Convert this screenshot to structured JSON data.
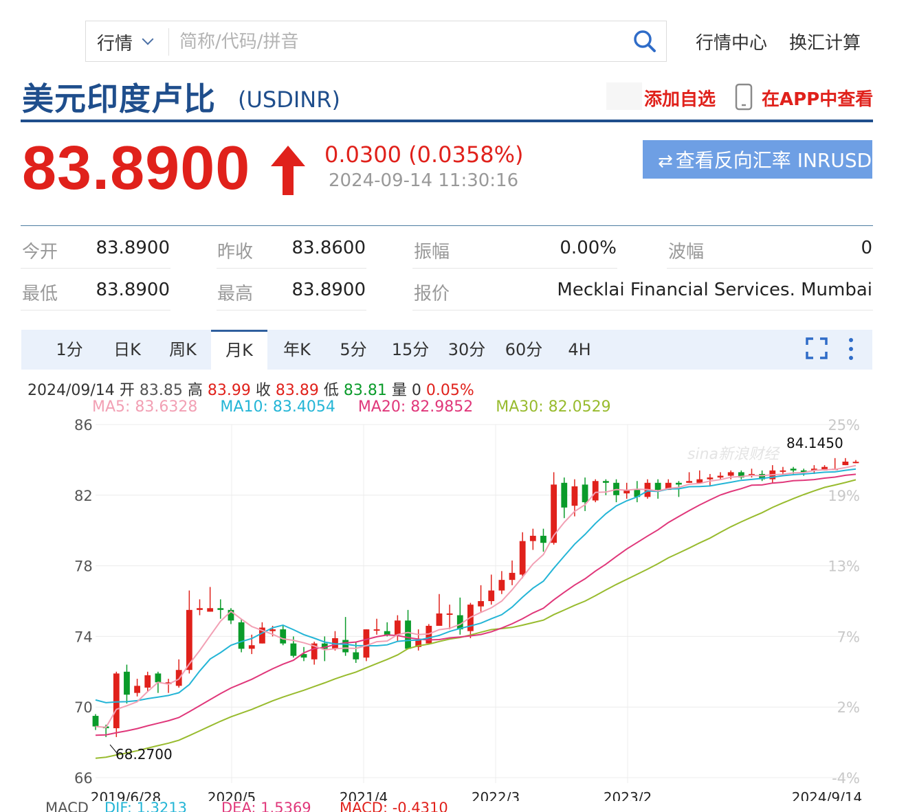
{
  "search": {
    "market_label": "行情",
    "placeholder": "简称/代码/拼音"
  },
  "nav": {
    "market_center": "行情中心",
    "fx_calc": "换汇计算"
  },
  "header": {
    "title": "美元印度卢比",
    "symbol": "(USDINR)",
    "add_favorite": "添加自选",
    "view_in_app": "在APP中查看"
  },
  "quote": {
    "price": "83.8900",
    "change": "0.0300 (0.0358%)",
    "timestamp": "2024-09-14 11:30:16",
    "reverse_button": "查看反向汇率 INRUSD",
    "up_color": "#e0211b"
  },
  "stats": {
    "open_label": "今开",
    "open_value": "83.8900",
    "prev_close_label": "昨收",
    "prev_close_value": "83.8600",
    "amplitude_label": "振幅",
    "amplitude_value": "0.00%",
    "wave_label": "波幅",
    "wave_value": "0",
    "low_label": "最低",
    "low_value": "83.8900",
    "high_label": "最高",
    "high_value": "83.8900",
    "quote_label": "报价",
    "quote_value": "Mecklai Financial Services. Mumbai"
  },
  "tabs": [
    "1分",
    "日K",
    "周K",
    "月K",
    "年K",
    "5分",
    "15分",
    "30分",
    "60分",
    "4H"
  ],
  "active_tab": "月K",
  "ohlc_bar": {
    "date": "2024/09/14",
    "open_label": "开",
    "open": "83.85",
    "high_label": "高",
    "high": "83.99",
    "close_label": "收",
    "close": "83.89",
    "low_label": "低",
    "low": "83.81",
    "volume_label": "量",
    "volume": "0",
    "pct": "0.05%"
  },
  "ma_legend": {
    "ma5": "MA5: 83.6328",
    "ma10": "MA10: 83.4054",
    "ma20": "MA20: 82.9852",
    "ma30": "MA30: 82.0529"
  },
  "macd_legend": {
    "title": "MACD",
    "dif": "DIF: 1.3213",
    "dea": "DEA: 1.5369",
    "macd": "MACD: -0.4310"
  },
  "chart_data": {
    "type": "candlestick",
    "title": "",
    "y_ticks": [
      86,
      82,
      78,
      74,
      70,
      66
    ],
    "right_ticks": [
      "25%",
      "19%",
      "13%",
      "7%",
      "2%",
      "-4%"
    ],
    "ylim": [
      66,
      86
    ],
    "x_ticks": [
      "2019/6/28",
      "2020/5",
      "2021/4",
      "2022/3",
      "2023/2",
      "2024/9/14"
    ],
    "max_label": "84.1450",
    "min_label": "68.2700",
    "watermark": "sina新浪财经",
    "grid": true,
    "colors": {
      "up": "#e0211b",
      "down": "#0a9b2a",
      "ma5": "#f2a0b4",
      "ma10": "#24b5d6",
      "ma20": "#e0377a",
      "ma30": "#98bb2e"
    },
    "candles": [
      [
        69.5,
        68.9,
        69.6,
        68.7
      ],
      [
        68.9,
        68.8,
        69.0,
        68.3
      ],
      [
        68.8,
        71.9,
        72.0,
        68.3
      ],
      [
        72.0,
        70.7,
        72.4,
        70.2
      ],
      [
        70.8,
        71.2,
        71.6,
        70.6
      ],
      [
        71.1,
        71.8,
        72.0,
        70.9
      ],
      [
        71.9,
        71.4,
        72.0,
        70.8
      ],
      [
        71.3,
        71.4,
        71.6,
        70.8
      ],
      [
        71.2,
        72.1,
        72.7,
        71.1
      ],
      [
        72.1,
        75.5,
        76.6,
        71.9
      ],
      [
        75.5,
        75.6,
        76.1,
        75.2
      ],
      [
        75.4,
        75.6,
        76.8,
        75.4
      ],
      [
        75.6,
        75.5,
        76.1,
        75.0
      ],
      [
        75.5,
        74.9,
        75.6,
        74.7
      ],
      [
        74.8,
        73.3,
        75.0,
        73.1
      ],
      [
        73.3,
        73.5,
        74.1,
        73.0
      ],
      [
        73.6,
        74.5,
        74.8,
        73.6
      ],
      [
        74.3,
        74.4,
        74.6,
        74.0
      ],
      [
        74.4,
        73.6,
        74.6,
        73.5
      ],
      [
        73.6,
        72.9,
        74.0,
        72.8
      ],
      [
        73.0,
        72.8,
        73.4,
        72.6
      ],
      [
        72.7,
        73.6,
        73.7,
        72.4
      ],
      [
        73.6,
        73.3,
        74.0,
        72.6
      ],
      [
        73.3,
        73.9,
        74.3,
        73.2
      ],
      [
        73.8,
        73.1,
        75.1,
        72.9
      ],
      [
        73.1,
        72.7,
        73.7,
        72.5
      ],
      [
        72.8,
        74.4,
        74.4,
        72.6
      ],
      [
        74.4,
        74.4,
        75.0,
        74.1
      ],
      [
        74.3,
        74.1,
        74.8,
        74.0
      ],
      [
        74.1,
        74.9,
        75.2,
        73.7
      ],
      [
        74.9,
        73.3,
        75.5,
        73.3
      ],
      [
        73.4,
        73.8,
        74.4,
        73.2
      ],
      [
        73.6,
        74.6,
        74.7,
        73.6
      ],
      [
        74.6,
        75.3,
        76.4,
        74.6
      ],
      [
        75.3,
        75.3,
        75.8,
        74.4
      ],
      [
        75.2,
        74.4,
        76.2,
        74.1
      ],
      [
        74.3,
        75.8,
        75.9,
        73.9
      ],
      [
        75.7,
        76.0,
        76.9,
        75.4
      ],
      [
        76.0,
        76.6,
        77.5,
        75.8
      ],
      [
        76.6,
        77.2,
        77.7,
        76.4
      ],
      [
        77.2,
        77.6,
        78.3,
        76.9
      ],
      [
        77.5,
        79.4,
        79.9,
        77.3
      ],
      [
        79.4,
        79.7,
        80.1,
        78.9
      ],
      [
        79.7,
        79.3,
        80.1,
        78.8
      ],
      [
        79.3,
        82.6,
        83.3,
        79.2
      ],
      [
        82.7,
        81.3,
        83.0,
        80.7
      ],
      [
        81.4,
        82.5,
        82.9,
        80.8
      ],
      [
        82.6,
        81.6,
        83.0,
        81.1
      ],
      [
        81.7,
        82.8,
        82.9,
        81.6
      ],
      [
        82.8,
        82.7,
        82.9,
        82.0
      ],
      [
        82.7,
        82.0,
        82.9,
        81.6
      ],
      [
        82.1,
        82.3,
        82.7,
        81.8
      ],
      [
        82.3,
        81.9,
        82.8,
        81.6
      ],
      [
        81.9,
        82.7,
        82.9,
        81.8
      ],
      [
        82.7,
        82.3,
        82.9,
        81.8
      ],
      [
        82.3,
        82.7,
        82.9,
        82.3
      ],
      [
        82.7,
        82.6,
        82.8,
        81.9
      ],
      [
        82.7,
        82.8,
        83.3,
        82.7
      ],
      [
        82.7,
        82.9,
        83.4,
        82.7
      ],
      [
        82.9,
        83.0,
        83.2,
        82.5
      ],
      [
        83.0,
        83.1,
        83.3,
        82.9
      ],
      [
        83.1,
        83.3,
        83.4,
        82.9
      ],
      [
        83.3,
        83.0,
        83.4,
        82.9
      ],
      [
        83.1,
        83.2,
        83.5,
        83.0
      ],
      [
        83.2,
        82.9,
        83.4,
        82.8
      ],
      [
        82.9,
        83.4,
        83.7,
        82.7
      ],
      [
        83.4,
        83.4,
        83.6,
        83.1
      ],
      [
        83.5,
        83.4,
        83.6,
        83.2
      ],
      [
        83.4,
        83.3,
        83.5,
        83.1
      ],
      [
        83.4,
        83.5,
        83.7,
        83.2
      ],
      [
        83.4,
        83.6,
        83.7,
        83.4
      ],
      [
        83.5,
        83.5,
        84.1,
        83.5
      ],
      [
        83.7,
        83.9,
        84.1,
        83.7
      ],
      [
        83.85,
        83.89,
        83.99,
        83.81
      ]
    ]
  }
}
